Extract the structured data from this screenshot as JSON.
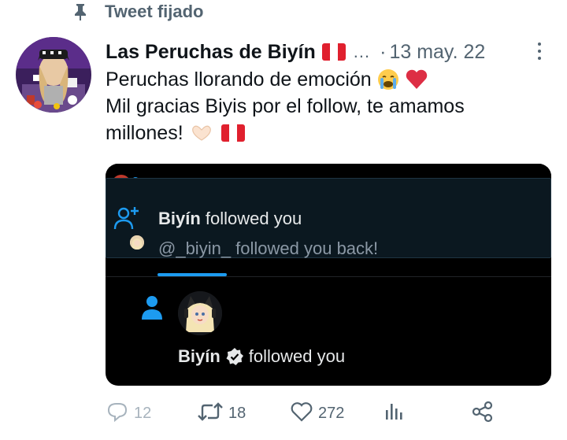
{
  "pinned": {
    "label": "Tweet fijado"
  },
  "tweet": {
    "author_name": "Las Peruchas de Biyín",
    "handle_ellipsis": "...",
    "separator": "·",
    "date": "13 may. 22",
    "lines": [
      "Peruchas llorando de emoción",
      "Mil gracias Biyis por el follow, te amamos",
      "millones!"
    ]
  },
  "media": {
    "notification": {
      "name": "Biyín",
      "action": "followed you",
      "subline": "@_biyin_ followed you back!"
    },
    "follow_entry": {
      "name": "Biyín",
      "action": "followed you"
    }
  },
  "actions": {
    "replies": "12",
    "retweets": "18",
    "likes": "272"
  },
  "colors": {
    "text_primary": "#0f1419",
    "text_secondary": "#536471",
    "accent": "#1d9bf0",
    "peru_red": "#e0202e"
  },
  "icons": [
    "pin-icon",
    "more-icon",
    "crying-emoji-icon",
    "red-heart-icon",
    "heart-hands-icon",
    "peru-flag-icon",
    "follow-add-icon",
    "person-icon",
    "verified-icon",
    "reply-icon",
    "retweet-icon",
    "like-icon",
    "analytics-icon",
    "share-icon"
  ]
}
